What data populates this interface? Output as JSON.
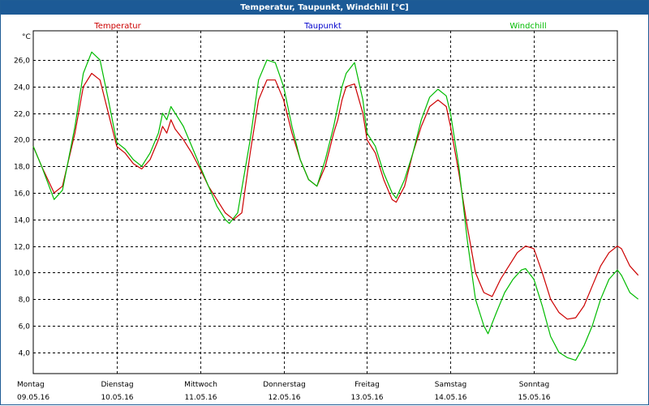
{
  "window": {
    "title": "Temperatur, Taupunkt, Windchill [°C]"
  },
  "colors": {
    "titlebar": "#1c5a96",
    "temperatur": "#cc0000",
    "taupunkt": "#0000cc",
    "windchill": "#00bb00"
  },
  "chart_data": {
    "type": "line",
    "title": "Temperatur, Taupunkt, Windchill [°C]",
    "ylabel": "°C",
    "ylim": [
      2.4,
      28.2
    ],
    "xlim": [
      0,
      7
    ],
    "grid": true,
    "legend_position": "top",
    "yticks": [
      "4,0",
      "6,0",
      "8,0",
      "10,0",
      "12,0",
      "14,0",
      "16,0",
      "18,0",
      "20,0",
      "22,0",
      "24,0",
      "26,0"
    ],
    "xticks": [
      {
        "day": "Montag",
        "date": "09.05.16"
      },
      {
        "day": "Dienstag",
        "date": "10.05.16"
      },
      {
        "day": "Mittwoch",
        "date": "11.05.16"
      },
      {
        "day": "Donnerstag",
        "date": "12.05.16"
      },
      {
        "day": "Freitag",
        "date": "13.05.16"
      },
      {
        "day": "Samstag",
        "date": "14.05.16"
      },
      {
        "day": "Sonntag",
        "date": "15.05.16"
      }
    ],
    "series": [
      {
        "name": "Temperatur",
        "color": "#cc0000",
        "points": [
          [
            0,
            19.5
          ],
          [
            0.1,
            18.0
          ],
          [
            0.25,
            16.0
          ],
          [
            0.35,
            16.5
          ],
          [
            0.5,
            20.5
          ],
          [
            0.6,
            24.0
          ],
          [
            0.7,
            25.0
          ],
          [
            0.8,
            24.5
          ],
          [
            0.9,
            22.0
          ],
          [
            1.0,
            19.5
          ],
          [
            1.1,
            19.0
          ],
          [
            1.2,
            18.2
          ],
          [
            1.3,
            17.8
          ],
          [
            1.4,
            18.5
          ],
          [
            1.5,
            20.0
          ],
          [
            1.55,
            21.0
          ],
          [
            1.6,
            20.5
          ],
          [
            1.65,
            21.5
          ],
          [
            1.7,
            20.8
          ],
          [
            1.8,
            20.0
          ],
          [
            1.9,
            19.0
          ],
          [
            2.0,
            17.8
          ],
          [
            2.1,
            16.5
          ],
          [
            2.2,
            15.5
          ],
          [
            2.3,
            14.5
          ],
          [
            2.4,
            14.0
          ],
          [
            2.5,
            14.5
          ],
          [
            2.6,
            19.0
          ],
          [
            2.7,
            23.0
          ],
          [
            2.8,
            24.5
          ],
          [
            2.9,
            24.5
          ],
          [
            3.0,
            23.0
          ],
          [
            3.1,
            20.5
          ],
          [
            3.2,
            18.5
          ],
          [
            3.3,
            17.0
          ],
          [
            3.4,
            16.5
          ],
          [
            3.5,
            18.0
          ],
          [
            3.6,
            20.5
          ],
          [
            3.65,
            21.5
          ],
          [
            3.7,
            23.0
          ],
          [
            3.75,
            24.0
          ],
          [
            3.85,
            24.2
          ],
          [
            3.95,
            22.0
          ],
          [
            4.0,
            20.0
          ],
          [
            4.1,
            19.0
          ],
          [
            4.2,
            17.0
          ],
          [
            4.3,
            15.5
          ],
          [
            4.35,
            15.3
          ],
          [
            4.45,
            16.5
          ],
          [
            4.55,
            19.0
          ],
          [
            4.65,
            21.0
          ],
          [
            4.75,
            22.5
          ],
          [
            4.85,
            23.0
          ],
          [
            4.95,
            22.5
          ],
          [
            5.0,
            21.0
          ],
          [
            5.1,
            17.5
          ],
          [
            5.2,
            13.5
          ],
          [
            5.3,
            10.0
          ],
          [
            5.4,
            8.5
          ],
          [
            5.5,
            8.2
          ],
          [
            5.6,
            9.5
          ],
          [
            5.7,
            10.5
          ],
          [
            5.8,
            11.5
          ],
          [
            5.9,
            12.0
          ],
          [
            6.0,
            11.8
          ],
          [
            6.1,
            10.0
          ],
          [
            6.2,
            8.0
          ],
          [
            6.3,
            7.0
          ],
          [
            6.4,
            6.5
          ],
          [
            6.5,
            6.6
          ],
          [
            6.6,
            7.5
          ],
          [
            6.7,
            9.0
          ],
          [
            6.8,
            10.5
          ],
          [
            6.9,
            11.5
          ],
          [
            7.0,
            12.0
          ],
          [
            7.05,
            11.8
          ],
          [
            7.15,
            10.5
          ],
          [
            7.25,
            9.8
          ]
        ]
      },
      {
        "name": "Windchill",
        "color": "#00bb00",
        "points": [
          [
            0,
            19.5
          ],
          [
            0.1,
            18.0
          ],
          [
            0.25,
            15.5
          ],
          [
            0.35,
            16.2
          ],
          [
            0.5,
            21.0
          ],
          [
            0.6,
            25.0
          ],
          [
            0.7,
            26.6
          ],
          [
            0.8,
            26.0
          ],
          [
            0.9,
            23.0
          ],
          [
            1.0,
            19.8
          ],
          [
            1.1,
            19.3
          ],
          [
            1.2,
            18.5
          ],
          [
            1.3,
            18.0
          ],
          [
            1.4,
            19.0
          ],
          [
            1.5,
            20.5
          ],
          [
            1.55,
            22.0
          ],
          [
            1.6,
            21.5
          ],
          [
            1.65,
            22.5
          ],
          [
            1.7,
            22.0
          ],
          [
            1.8,
            21.0
          ],
          [
            1.9,
            19.5
          ],
          [
            2.0,
            18.0
          ],
          [
            2.1,
            16.5
          ],
          [
            2.2,
            15.0
          ],
          [
            2.3,
            14.0
          ],
          [
            2.35,
            13.7
          ],
          [
            2.45,
            14.5
          ],
          [
            2.6,
            20.0
          ],
          [
            2.7,
            24.5
          ],
          [
            2.8,
            26.0
          ],
          [
            2.9,
            25.8
          ],
          [
            3.0,
            24.0
          ],
          [
            3.1,
            21.0
          ],
          [
            3.2,
            18.5
          ],
          [
            3.3,
            17.0
          ],
          [
            3.4,
            16.5
          ],
          [
            3.5,
            18.5
          ],
          [
            3.6,
            21.0
          ],
          [
            3.65,
            22.5
          ],
          [
            3.7,
            24.0
          ],
          [
            3.75,
            25.0
          ],
          [
            3.85,
            25.8
          ],
          [
            3.95,
            23.0
          ],
          [
            4.0,
            20.5
          ],
          [
            4.1,
            19.5
          ],
          [
            4.2,
            17.5
          ],
          [
            4.3,
            16.0
          ],
          [
            4.35,
            15.6
          ],
          [
            4.45,
            17.0
          ],
          [
            4.55,
            19.0
          ],
          [
            4.65,
            21.5
          ],
          [
            4.75,
            23.2
          ],
          [
            4.85,
            23.8
          ],
          [
            4.95,
            23.3
          ],
          [
            5.0,
            22.0
          ],
          [
            5.1,
            18.0
          ],
          [
            5.2,
            12.5
          ],
          [
            5.3,
            8.0
          ],
          [
            5.4,
            6.0
          ],
          [
            5.45,
            5.4
          ],
          [
            5.55,
            7.0
          ],
          [
            5.65,
            8.5
          ],
          [
            5.75,
            9.5
          ],
          [
            5.85,
            10.2
          ],
          [
            5.9,
            10.3
          ],
          [
            6.0,
            9.5
          ],
          [
            6.1,
            7.5
          ],
          [
            6.2,
            5.2
          ],
          [
            6.3,
            4.0
          ],
          [
            6.4,
            3.6
          ],
          [
            6.5,
            3.4
          ],
          [
            6.6,
            4.5
          ],
          [
            6.7,
            6.0
          ],
          [
            6.8,
            8.0
          ],
          [
            6.9,
            9.5
          ],
          [
            7.0,
            10.2
          ],
          [
            7.05,
            9.8
          ],
          [
            7.15,
            8.5
          ],
          [
            7.25,
            8.0
          ]
        ]
      }
    ],
    "legend": [
      {
        "name": "Temperatur",
        "color": "#cc0000"
      },
      {
        "name": "Taupunkt",
        "color": "#0000cc"
      },
      {
        "name": "Windchill",
        "color": "#00bb00"
      }
    ]
  }
}
